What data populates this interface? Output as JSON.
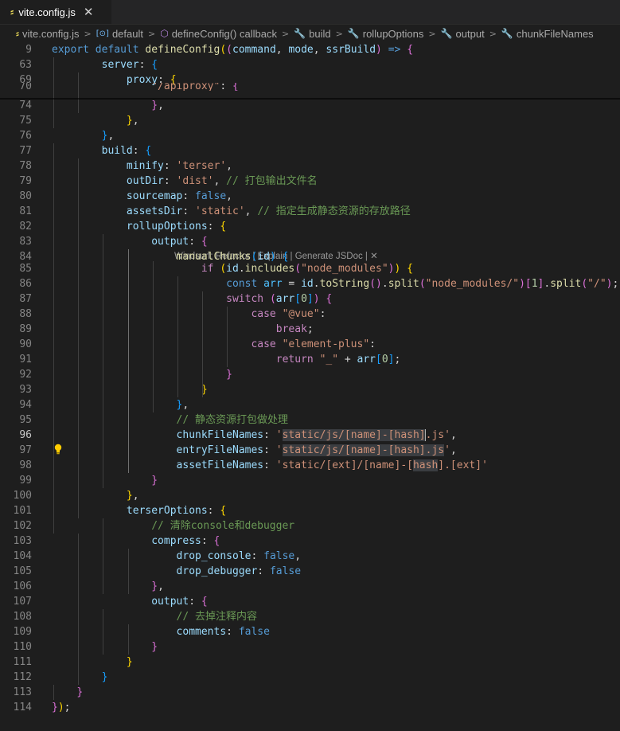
{
  "tab": {
    "icon": "js-file-icon",
    "title": "vite.config.js",
    "close": "✕"
  },
  "breadcrumb": {
    "items": [
      {
        "icon": "js-file-icon",
        "label": "vite.config.js"
      },
      {
        "icon": "variable-icon",
        "label": "default"
      },
      {
        "icon": "method-cube-icon",
        "label": "defineConfig() callback"
      },
      {
        "icon": "wrench-icon",
        "label": "build"
      },
      {
        "icon": "wrench-icon",
        "label": "rollupOptions"
      },
      {
        "icon": "wrench-icon",
        "label": "output"
      },
      {
        "icon": "wrench-icon",
        "label": "chunkFileNames"
      }
    ],
    "separator": ">"
  },
  "codelens": "Windsurf: Refactor | Explain | Generate JSDoc | ✕",
  "current_line": 96,
  "lines": [
    {
      "n": "9",
      "tokens": [
        [
          "k",
          "export"
        ],
        [
          "d",
          " "
        ],
        [
          "k",
          "default"
        ],
        [
          "d",
          " "
        ],
        [
          "f",
          "defineConfig"
        ],
        [
          "b1",
          "("
        ],
        [
          "b2",
          "("
        ],
        [
          "v",
          "command"
        ],
        [
          "d",
          ", "
        ],
        [
          "v",
          "mode"
        ],
        [
          "d",
          ", "
        ],
        [
          "v",
          "ssrBuild"
        ],
        [
          "b2",
          ")"
        ],
        [
          "d",
          " "
        ],
        [
          "k",
          "=>"
        ],
        [
          "d",
          " "
        ],
        [
          "b2",
          "{"
        ]
      ]
    },
    {
      "n": "63",
      "tokens": [
        [
          "d",
          "        "
        ],
        [
          "v",
          "server"
        ],
        [
          "d",
          ": "
        ],
        [
          "b3",
          "{"
        ]
      ]
    },
    {
      "n": "69",
      "tokens": [
        [
          "d",
          "            "
        ],
        [
          "v",
          "proxy"
        ],
        [
          "d",
          ": "
        ],
        [
          "b1",
          "{"
        ]
      ]
    },
    {
      "n": "70",
      "tokens": [
        [
          "d",
          "                "
        ],
        [
          "s",
          "\"/apiproxy\""
        ],
        [
          "d",
          ": "
        ],
        [
          "b2",
          "{"
        ]
      ]
    },
    {
      "n": "74",
      "tokens": [
        [
          "d",
          "                "
        ],
        [
          "b2",
          "}"
        ],
        [
          "d",
          ","
        ]
      ]
    },
    {
      "n": "75",
      "tokens": [
        [
          "d",
          "            "
        ],
        [
          "b1",
          "}"
        ],
        [
          "d",
          ","
        ]
      ]
    },
    {
      "n": "76",
      "tokens": [
        [
          "d",
          "        "
        ],
        [
          "b3",
          "}"
        ],
        [
          "d",
          ","
        ]
      ]
    },
    {
      "n": "77",
      "tokens": [
        [
          "d",
          "        "
        ],
        [
          "v",
          "build"
        ],
        [
          "d",
          ": "
        ],
        [
          "b3",
          "{"
        ]
      ]
    },
    {
      "n": "78",
      "tokens": [
        [
          "d",
          "            "
        ],
        [
          "v",
          "minify"
        ],
        [
          "d",
          ": "
        ],
        [
          "s",
          "'terser'"
        ],
        [
          "d",
          ","
        ]
      ]
    },
    {
      "n": "79",
      "tokens": [
        [
          "d",
          "            "
        ],
        [
          "v",
          "outDir"
        ],
        [
          "d",
          ": "
        ],
        [
          "s",
          "'dist'"
        ],
        [
          "d",
          ", "
        ],
        [
          "m",
          "// 打包输出文件名"
        ]
      ]
    },
    {
      "n": "80",
      "tokens": [
        [
          "d",
          "            "
        ],
        [
          "v",
          "sourcemap"
        ],
        [
          "d",
          ": "
        ],
        [
          "k",
          "false"
        ],
        [
          "d",
          ","
        ]
      ]
    },
    {
      "n": "81",
      "tokens": [
        [
          "d",
          "            "
        ],
        [
          "v",
          "assetsDir"
        ],
        [
          "d",
          ": "
        ],
        [
          "s",
          "'static'"
        ],
        [
          "d",
          ", "
        ],
        [
          "m",
          "// 指定生成静态资源的存放路径"
        ]
      ]
    },
    {
      "n": "82",
      "tokens": [
        [
          "d",
          "            "
        ],
        [
          "v",
          "rollupOptions"
        ],
        [
          "d",
          ": "
        ],
        [
          "b1",
          "{"
        ]
      ]
    },
    {
      "n": "83",
      "tokens": [
        [
          "d",
          "                "
        ],
        [
          "v",
          "output"
        ],
        [
          "d",
          ": "
        ],
        [
          "b2",
          "{"
        ]
      ]
    },
    {
      "n": "84",
      "tokens": [
        [
          "d",
          "                    "
        ],
        [
          "f",
          "manualChunks"
        ],
        [
          "b3",
          "("
        ],
        [
          "v",
          "id"
        ],
        [
          "b3",
          ")"
        ],
        [
          "d",
          " "
        ],
        [
          "b3",
          "{"
        ]
      ]
    },
    {
      "n": "85",
      "tokens": [
        [
          "d",
          "                        "
        ],
        [
          "c",
          "if"
        ],
        [
          "d",
          " "
        ],
        [
          "b1",
          "("
        ],
        [
          "v",
          "id"
        ],
        [
          "d",
          "."
        ],
        [
          "f",
          "includes"
        ],
        [
          "b2",
          "("
        ],
        [
          "s",
          "\"node_modules\""
        ],
        [
          "b2",
          ")"
        ],
        [
          "b1",
          ")"
        ],
        [
          "d",
          " "
        ],
        [
          "b1",
          "{"
        ]
      ]
    },
    {
      "n": "86",
      "tokens": [
        [
          "d",
          "                            "
        ],
        [
          "k",
          "const"
        ],
        [
          "d",
          " "
        ],
        [
          "cst",
          "arr"
        ],
        [
          "d",
          " = "
        ],
        [
          "v",
          "id"
        ],
        [
          "d",
          "."
        ],
        [
          "f",
          "toString"
        ],
        [
          "b2",
          "()"
        ],
        [
          "d",
          "."
        ],
        [
          "f",
          "split"
        ],
        [
          "b2",
          "("
        ],
        [
          "s",
          "\"node_modules/\""
        ],
        [
          "b2",
          ")"
        ],
        [
          "b2",
          "["
        ],
        [
          "n",
          "1"
        ],
        [
          "b2",
          "]"
        ],
        [
          "d",
          "."
        ],
        [
          "f",
          "split"
        ],
        [
          "b2",
          "("
        ],
        [
          "s",
          "\"/\""
        ],
        [
          "b2",
          ")"
        ],
        [
          "d",
          ";"
        ]
      ]
    },
    {
      "n": "87",
      "tokens": [
        [
          "d",
          "                            "
        ],
        [
          "c",
          "switch"
        ],
        [
          "d",
          " "
        ],
        [
          "b2",
          "("
        ],
        [
          "v",
          "arr"
        ],
        [
          "b3",
          "["
        ],
        [
          "n",
          "0"
        ],
        [
          "b3",
          "]"
        ],
        [
          "b2",
          ")"
        ],
        [
          "d",
          " "
        ],
        [
          "b2",
          "{"
        ]
      ]
    },
    {
      "n": "88",
      "tokens": [
        [
          "d",
          "                                "
        ],
        [
          "c",
          "case"
        ],
        [
          "d",
          " "
        ],
        [
          "s",
          "\"@vue\""
        ],
        [
          "d",
          ":"
        ]
      ]
    },
    {
      "n": "89",
      "tokens": [
        [
          "d",
          "                                    "
        ],
        [
          "c",
          "break"
        ],
        [
          "d",
          ";"
        ]
      ]
    },
    {
      "n": "90",
      "tokens": [
        [
          "d",
          "                                "
        ],
        [
          "c",
          "case"
        ],
        [
          "d",
          " "
        ],
        [
          "s",
          "\"element-plus\""
        ],
        [
          "d",
          ":"
        ]
      ]
    },
    {
      "n": "91",
      "tokens": [
        [
          "d",
          "                                    "
        ],
        [
          "c",
          "return"
        ],
        [
          "d",
          " "
        ],
        [
          "s",
          "\"_\""
        ],
        [
          "d",
          " + "
        ],
        [
          "v",
          "arr"
        ],
        [
          "b3",
          "["
        ],
        [
          "n",
          "0"
        ],
        [
          "b3",
          "]"
        ],
        [
          "d",
          ";"
        ]
      ]
    },
    {
      "n": "92",
      "tokens": [
        [
          "d",
          "                            "
        ],
        [
          "b2",
          "}"
        ]
      ]
    },
    {
      "n": "93",
      "tokens": [
        [
          "d",
          "                        "
        ],
        [
          "b1",
          "}"
        ]
      ]
    },
    {
      "n": "94",
      "tokens": [
        [
          "d",
          "                    "
        ],
        [
          "b3",
          "}"
        ],
        [
          "d",
          ","
        ]
      ]
    },
    {
      "n": "95",
      "tokens": [
        [
          "d",
          "                    "
        ],
        [
          "m",
          "// 静态资源打包做处理"
        ]
      ]
    },
    {
      "n": "96",
      "tokens": [
        [
          "d",
          "                    "
        ],
        [
          "v",
          "chunkFileNames"
        ],
        [
          "d",
          ": "
        ],
        [
          "s",
          "'"
        ],
        [
          "s hl",
          "static/js/[name]-[hash]"
        ],
        [
          "s",
          ".js'"
        ],
        [
          "d",
          ","
        ]
      ]
    },
    {
      "n": "97",
      "tokens": [
        [
          "d",
          "                    "
        ],
        [
          "v",
          "entryFileNames"
        ],
        [
          "d",
          ": "
        ],
        [
          "s",
          "'"
        ],
        [
          "s hl",
          "static/js/[name]-[hash].js"
        ],
        [
          "s",
          "'"
        ],
        [
          "d",
          ","
        ]
      ]
    },
    {
      "n": "98",
      "tokens": [
        [
          "d",
          "                    "
        ],
        [
          "v",
          "assetFileNames"
        ],
        [
          "d",
          ": "
        ],
        [
          "s",
          "'static/[ext]/[name]-["
        ],
        [
          "s hl",
          "hash"
        ],
        [
          "s",
          "].[ext]'"
        ]
      ]
    },
    {
      "n": "99",
      "tokens": [
        [
          "d",
          "                "
        ],
        [
          "b2",
          "}"
        ]
      ]
    },
    {
      "n": "100",
      "tokens": [
        [
          "d",
          "            "
        ],
        [
          "b1",
          "}"
        ],
        [
          "d",
          ","
        ]
      ]
    },
    {
      "n": "101",
      "tokens": [
        [
          "d",
          "            "
        ],
        [
          "v",
          "terserOptions"
        ],
        [
          "d",
          ": "
        ],
        [
          "b1",
          "{"
        ]
      ]
    },
    {
      "n": "102",
      "tokens": [
        [
          "d",
          "                "
        ],
        [
          "m",
          "// 清除console和debugger"
        ]
      ]
    },
    {
      "n": "103",
      "tokens": [
        [
          "d",
          "                "
        ],
        [
          "v",
          "compress"
        ],
        [
          "d",
          ": "
        ],
        [
          "b2",
          "{"
        ]
      ]
    },
    {
      "n": "104",
      "tokens": [
        [
          "d",
          "                    "
        ],
        [
          "v",
          "drop_console"
        ],
        [
          "d",
          ": "
        ],
        [
          "k",
          "false"
        ],
        [
          "d",
          ","
        ]
      ]
    },
    {
      "n": "105",
      "tokens": [
        [
          "d",
          "                    "
        ],
        [
          "v",
          "drop_debugger"
        ],
        [
          "d",
          ": "
        ],
        [
          "k",
          "false"
        ]
      ]
    },
    {
      "n": "106",
      "tokens": [
        [
          "d",
          "                "
        ],
        [
          "b2",
          "}"
        ],
        [
          "d",
          ","
        ]
      ]
    },
    {
      "n": "107",
      "tokens": [
        [
          "d",
          "                "
        ],
        [
          "v",
          "output"
        ],
        [
          "d",
          ": "
        ],
        [
          "b2",
          "{"
        ]
      ]
    },
    {
      "n": "108",
      "tokens": [
        [
          "d",
          "                    "
        ],
        [
          "m",
          "// 去掉注释内容"
        ]
      ]
    },
    {
      "n": "109",
      "tokens": [
        [
          "d",
          "                    "
        ],
        [
          "v",
          "comments"
        ],
        [
          "d",
          ": "
        ],
        [
          "k",
          "false"
        ]
      ]
    },
    {
      "n": "110",
      "tokens": [
        [
          "d",
          "                "
        ],
        [
          "b2",
          "}"
        ]
      ]
    },
    {
      "n": "111",
      "tokens": [
        [
          "d",
          "            "
        ],
        [
          "b1",
          "}"
        ]
      ]
    },
    {
      "n": "112",
      "tokens": [
        [
          "d",
          "        "
        ],
        [
          "b3",
          "}"
        ]
      ]
    },
    {
      "n": "113",
      "tokens": [
        [
          "d",
          "    "
        ],
        [
          "b2",
          "}"
        ]
      ]
    },
    {
      "n": "114",
      "tokens": [
        [
          "b2",
          "}"
        ],
        [
          "b1",
          ")"
        ],
        [
          "d",
          ";"
        ]
      ]
    }
  ]
}
